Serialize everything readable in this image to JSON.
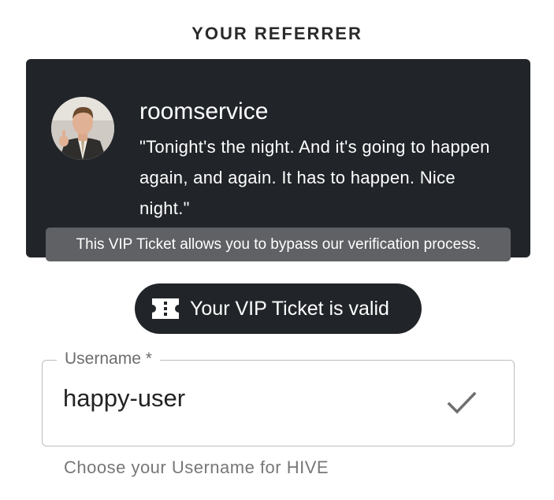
{
  "section_title": "YOUR REFERRER",
  "referrer": {
    "name": "roomservice",
    "quote": "\"Tonight's the night. And it's going to happen again, and again. It has to happen. Nice night.\""
  },
  "tooltip": "This VIP Ticket allows you to bypass our verification process.",
  "vip_ticket": {
    "icon": "ticket-icon",
    "label": "Your VIP Ticket is valid"
  },
  "username_field": {
    "label": "Username *",
    "value": "happy-user",
    "status_icon": "check-icon",
    "helper": "Choose your Username for HIVE"
  },
  "colors": {
    "card_bg": "#212529",
    "tooltip_bg": "#5f6164",
    "border": "#bdbdbd",
    "muted_text": "#777777"
  }
}
